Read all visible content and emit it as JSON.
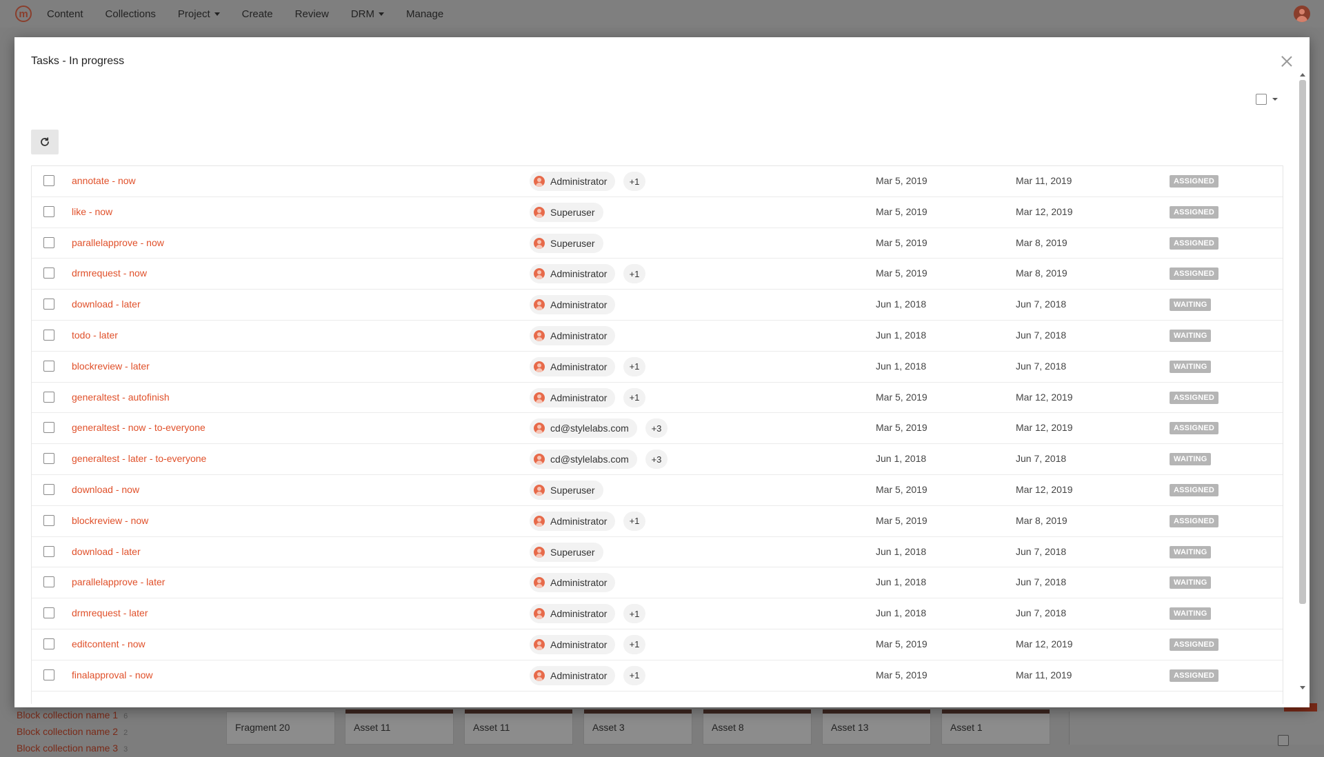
{
  "nav": {
    "logo": "m",
    "items": [
      {
        "label": "Content",
        "dropdown": false
      },
      {
        "label": "Collections",
        "dropdown": false
      },
      {
        "label": "Project",
        "dropdown": true
      },
      {
        "label": "Create",
        "dropdown": false
      },
      {
        "label": "Review",
        "dropdown": false
      },
      {
        "label": "DRM",
        "dropdown": true
      },
      {
        "label": "Manage",
        "dropdown": false
      }
    ]
  },
  "background": {
    "collections": [
      {
        "label": "Block collection name 1",
        "count": "6"
      },
      {
        "label": "Block collection name 2",
        "count": "2"
      },
      {
        "label": "Block collection name 3",
        "count": "3"
      }
    ],
    "tiles": [
      "Fragment 20",
      "Asset 11",
      "Asset 11",
      "Asset 3",
      "Asset 8",
      "Asset 13",
      "Asset 1"
    ]
  },
  "modal": {
    "title": "Tasks - In progress",
    "refresh_icon": "refresh-icon",
    "close_icon": "close-icon",
    "tasks": [
      {
        "name": "annotate - now",
        "assignee": "Administrator",
        "extra": "+1",
        "start": "Mar 5, 2019",
        "due": "Mar 11, 2019",
        "status": "ASSIGNED"
      },
      {
        "name": "like - now",
        "assignee": "Superuser",
        "extra": "",
        "start": "Mar 5, 2019",
        "due": "Mar 12, 2019",
        "status": "ASSIGNED"
      },
      {
        "name": "parallelapprove - now",
        "assignee": "Superuser",
        "extra": "",
        "start": "Mar 5, 2019",
        "due": "Mar 8, 2019",
        "status": "ASSIGNED"
      },
      {
        "name": "drmrequest - now",
        "assignee": "Administrator",
        "extra": "+1",
        "start": "Mar 5, 2019",
        "due": "Mar 8, 2019",
        "status": "ASSIGNED"
      },
      {
        "name": "download - later",
        "assignee": "Administrator",
        "extra": "",
        "start": "Jun 1, 2018",
        "due": "Jun 7, 2018",
        "status": "WAITING"
      },
      {
        "name": "todo - later",
        "assignee": "Administrator",
        "extra": "",
        "start": "Jun 1, 2018",
        "due": "Jun 7, 2018",
        "status": "WAITING"
      },
      {
        "name": "blockreview - later",
        "assignee": "Administrator",
        "extra": "+1",
        "start": "Jun 1, 2018",
        "due": "Jun 7, 2018",
        "status": "WAITING"
      },
      {
        "name": "generaltest - autofinish",
        "assignee": "Administrator",
        "extra": "+1",
        "start": "Mar 5, 2019",
        "due": "Mar 12, 2019",
        "status": "ASSIGNED"
      },
      {
        "name": "generaltest - now - to-everyone",
        "assignee": "cd@stylelabs.com",
        "extra": "+3",
        "start": "Mar 5, 2019",
        "due": "Mar 12, 2019",
        "status": "ASSIGNED"
      },
      {
        "name": "generaltest - later - to-everyone",
        "assignee": "cd@stylelabs.com",
        "extra": "+3",
        "start": "Jun 1, 2018",
        "due": "Jun 7, 2018",
        "status": "WAITING"
      },
      {
        "name": "download - now",
        "assignee": "Superuser",
        "extra": "",
        "start": "Mar 5, 2019",
        "due": "Mar 12, 2019",
        "status": "ASSIGNED"
      },
      {
        "name": "blockreview - now",
        "assignee": "Administrator",
        "extra": "+1",
        "start": "Mar 5, 2019",
        "due": "Mar 8, 2019",
        "status": "ASSIGNED"
      },
      {
        "name": "download - later",
        "assignee": "Superuser",
        "extra": "",
        "start": "Jun 1, 2018",
        "due": "Jun 7, 2018",
        "status": "WAITING"
      },
      {
        "name": "parallelapprove - later",
        "assignee": "Administrator",
        "extra": "",
        "start": "Jun 1, 2018",
        "due": "Jun 7, 2018",
        "status": "WAITING"
      },
      {
        "name": "drmrequest - later",
        "assignee": "Administrator",
        "extra": "+1",
        "start": "Jun 1, 2018",
        "due": "Jun 7, 2018",
        "status": "WAITING"
      },
      {
        "name": "editcontent - now",
        "assignee": "Administrator",
        "extra": "+1",
        "start": "Mar 5, 2019",
        "due": "Mar 12, 2019",
        "status": "ASSIGNED"
      },
      {
        "name": "finalapproval - now",
        "assignee": "Administrator",
        "extra": "+1",
        "start": "Mar 5, 2019",
        "due": "Mar 11, 2019",
        "status": "ASSIGNED"
      }
    ]
  },
  "colors": {
    "accent": "#e0502a",
    "status_badge": "#b5b5b5",
    "overlay": "#7d7d7d"
  }
}
